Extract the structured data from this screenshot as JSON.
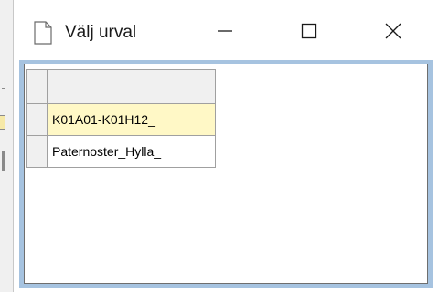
{
  "window": {
    "title": "Välj urval",
    "icon": "document-icon",
    "controls": {
      "minimize_glyph": "–",
      "maximize_glyph": "☐",
      "close_glyph": "✕"
    }
  },
  "grid": {
    "header": "",
    "rows": [
      {
        "value": "K01A01-K01H12_",
        "selected": true
      },
      {
        "value": "Paternoster_Hylla_",
        "selected": false
      }
    ]
  },
  "colors": {
    "selected_row": "#fff8c6",
    "frame": "#a6c3e0"
  }
}
